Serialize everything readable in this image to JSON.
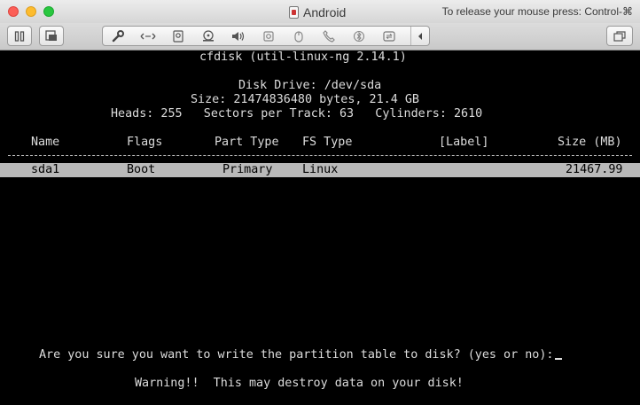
{
  "window": {
    "title": "Android",
    "release_hint": "To release your mouse press: Control-⌘",
    "title_icon": "vm-document-icon"
  },
  "toolbar": {
    "icons": [
      "pause-icon",
      "snapshot-icon",
      "settings-wrench-icon",
      "network-icon",
      "hard-disk-icon",
      "optical-drive-icon",
      "sound-icon",
      "camera-icon",
      "usb-mouse-icon",
      "phone-icon",
      "bluetooth-icon",
      "sync-icon",
      "collapse-arrow-icon",
      "fullscreen-icon"
    ]
  },
  "terminal": {
    "program": "cfdisk (util-linux-ng 2.14.1)",
    "disk_drive": "Disk Drive: /dev/sda",
    "size": "Size: 21474836480 bytes, 21.4 GB",
    "geometry": "Heads: 255   Sectors per Track: 63   Cylinders: 2610",
    "headers": {
      "name": "Name",
      "flags": "Flags",
      "part_type": "Part Type",
      "fs_type": "FS Type",
      "label": "[Label]",
      "size": "Size (MB)"
    },
    "partitions": [
      {
        "name": "sda1",
        "flags": "Boot",
        "part_type": "Primary",
        "fs_type": "Linux",
        "label": "",
        "size": "21467.99"
      }
    ],
    "prompt": "Are you sure you want to write the partition table to disk? (yes or no):",
    "warning": "Warning!!  This may destroy data on your disk!"
  },
  "colors": {
    "terminal_bg": "#000000",
    "terminal_fg": "#dddddd",
    "highlight_row": "#b9b9b9"
  }
}
